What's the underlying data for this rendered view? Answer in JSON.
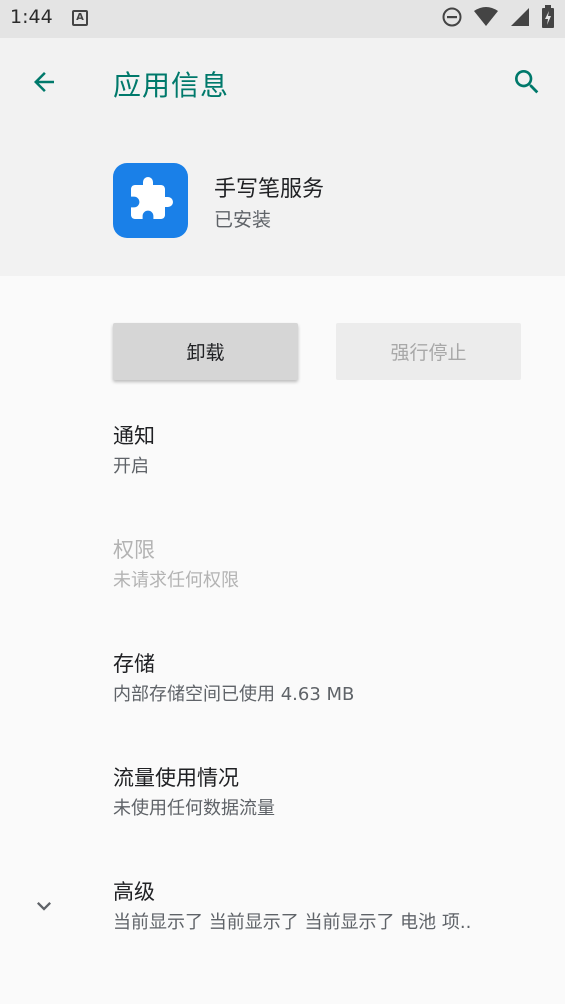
{
  "status_bar": {
    "time": "1:44",
    "notification_icon": "A",
    "icons": [
      "do-not-disturb-icon",
      "wifi-icon",
      "signal-icon",
      "battery-charging-icon"
    ]
  },
  "header": {
    "title": "应用信息",
    "back_icon": "arrow-back-icon",
    "search_icon": "search-icon"
  },
  "app": {
    "name": "手写笔服务",
    "status": "已安装",
    "icon": "puzzle-icon",
    "icon_color": "#1a80e8"
  },
  "buttons": {
    "uninstall": "卸载",
    "force_stop": "强行停止"
  },
  "items": [
    {
      "title": "通知",
      "subtitle": "开启"
    },
    {
      "title": "权限",
      "subtitle": "未请求任何权限"
    },
    {
      "title": "存储",
      "subtitle": "内部存储空间已使用 4.63 MB"
    },
    {
      "title": "流量使用情况",
      "subtitle": "未使用任何数据流量"
    },
    {
      "title": "高级",
      "subtitle": "当前显示了 当前显示了 当前显示了 电池 项.."
    }
  ],
  "colors": {
    "accent": "#00796b",
    "status_bar_bg": "#e4e4e4",
    "header_bg": "#f2f2f2",
    "page_bg": "#fafafa"
  }
}
